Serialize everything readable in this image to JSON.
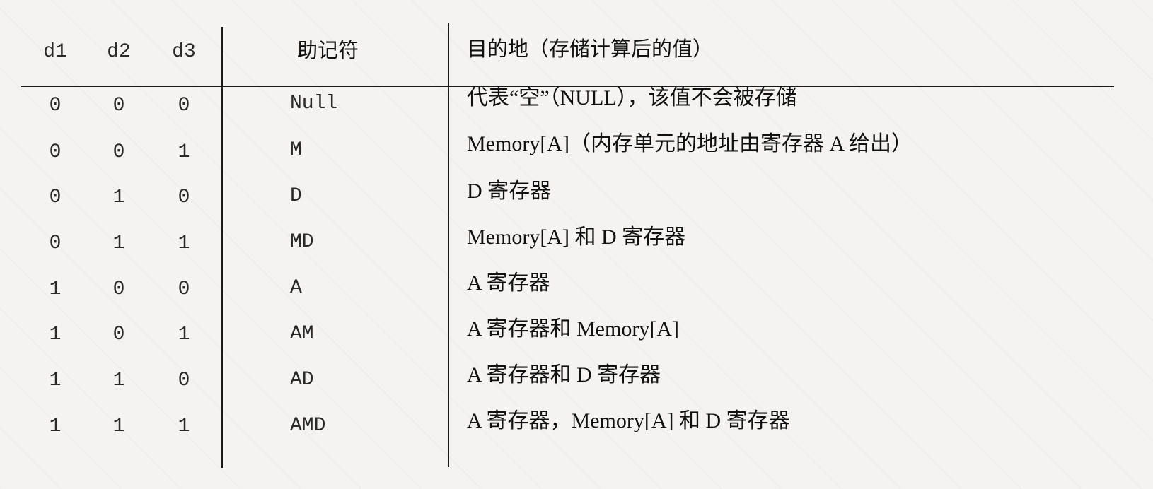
{
  "headers": {
    "d1": "d1",
    "d2": "d2",
    "d3": "d3",
    "mnemonic": "助记符",
    "destination": "目的地（存储计算后的值）"
  },
  "rows": [
    {
      "d1": "0",
      "d2": "0",
      "d3": "0",
      "mnemonic": "Null",
      "destination": "代表“空”（NULL），该值不会被存储"
    },
    {
      "d1": "0",
      "d2": "0",
      "d3": "1",
      "mnemonic": "M",
      "destination": "Memory[A]（内存单元的地址由寄存器 A 给出）"
    },
    {
      "d1": "0",
      "d2": "1",
      "d3": "0",
      "mnemonic": "D",
      "destination": "D 寄存器"
    },
    {
      "d1": "0",
      "d2": "1",
      "d3": "1",
      "mnemonic": "MD",
      "destination": "Memory[A] 和 D 寄存器"
    },
    {
      "d1": "1",
      "d2": "0",
      "d3": "0",
      "mnemonic": "A",
      "destination": "A 寄存器"
    },
    {
      "d1": "1",
      "d2": "0",
      "d3": "1",
      "mnemonic": "AM",
      "destination": "A 寄存器和 Memory[A]"
    },
    {
      "d1": "1",
      "d2": "1",
      "d3": "0",
      "mnemonic": "AD",
      "destination": "A 寄存器和 D 寄存器"
    },
    {
      "d1": "1",
      "d2": "1",
      "d3": "1",
      "mnemonic": "AMD",
      "destination": "A 寄存器，Memory[A] 和 D 寄存器"
    }
  ]
}
